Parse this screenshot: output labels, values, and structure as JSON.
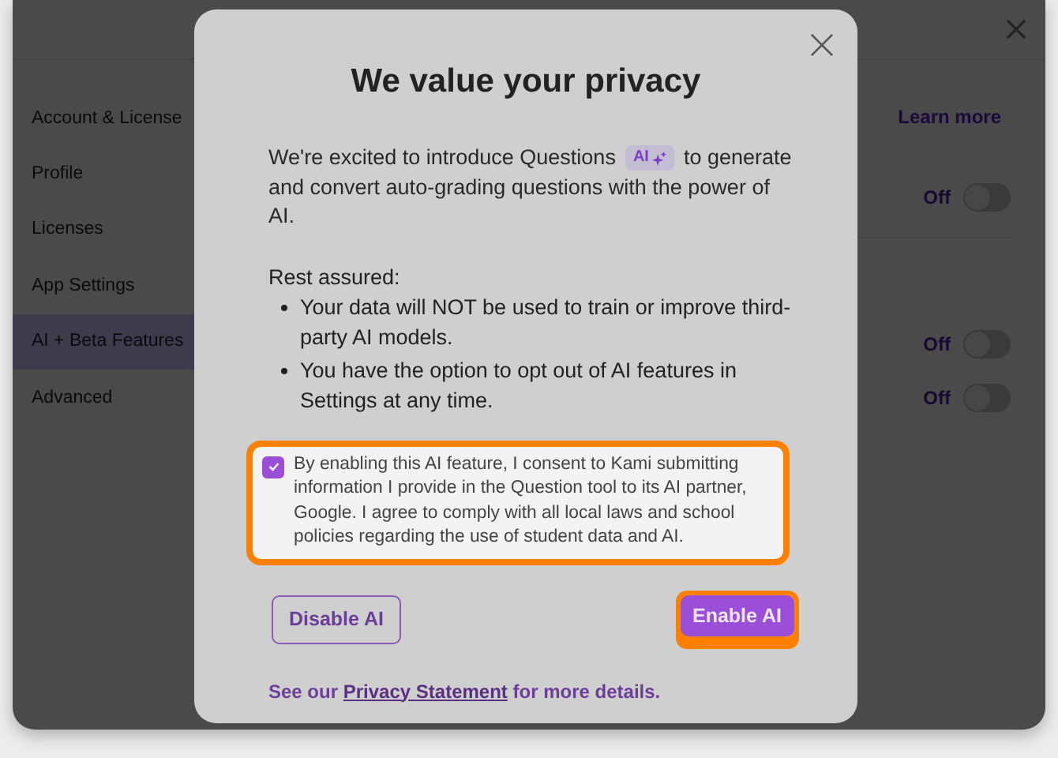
{
  "sidebar": {
    "items": [
      {
        "label": "Account & License",
        "selected": false
      },
      {
        "label": "Profile",
        "selected": false
      },
      {
        "label": "Licenses",
        "selected": false
      },
      {
        "label": "App Settings",
        "selected": false
      },
      {
        "label": "AI + Beta Features",
        "selected": true
      },
      {
        "label": "Advanced",
        "selected": false
      }
    ]
  },
  "settings": {
    "learn_more": "Learn more",
    "toggles": [
      {
        "label": "Off",
        "on": false
      },
      {
        "label": "Off",
        "on": false
      },
      {
        "label": "Off",
        "on": false
      }
    ]
  },
  "modal": {
    "title": "We value your privacy",
    "intro_start": "We're excited to introduce Questions",
    "badge": "AI",
    "intro_mid": "to generate",
    "intro_end": "and convert auto-grading questions with the power of AI.",
    "heading": "Rest assured:",
    "bullets": [
      "Your data will NOT be used to train or improve third-party AI models.",
      "You have the option to opt out of AI features in Settings at any time."
    ],
    "consent": {
      "checked": true,
      "highlighted": true,
      "text": "By enabling this AI feature, I consent to Kami submitting information I provide in the Question tool to its AI partner, Google. I agree to comply with all local laws and school policies regarding the use of student data and AI."
    },
    "buttons": [
      {
        "label": "Disable AI",
        "kind": "secondary",
        "highlighted": false
      },
      {
        "label": "Enable AI",
        "kind": "primary",
        "highlighted": true
      }
    ],
    "footer": {
      "before": "See our",
      "link": "Privacy Statement",
      "after": "for more details."
    }
  }
}
